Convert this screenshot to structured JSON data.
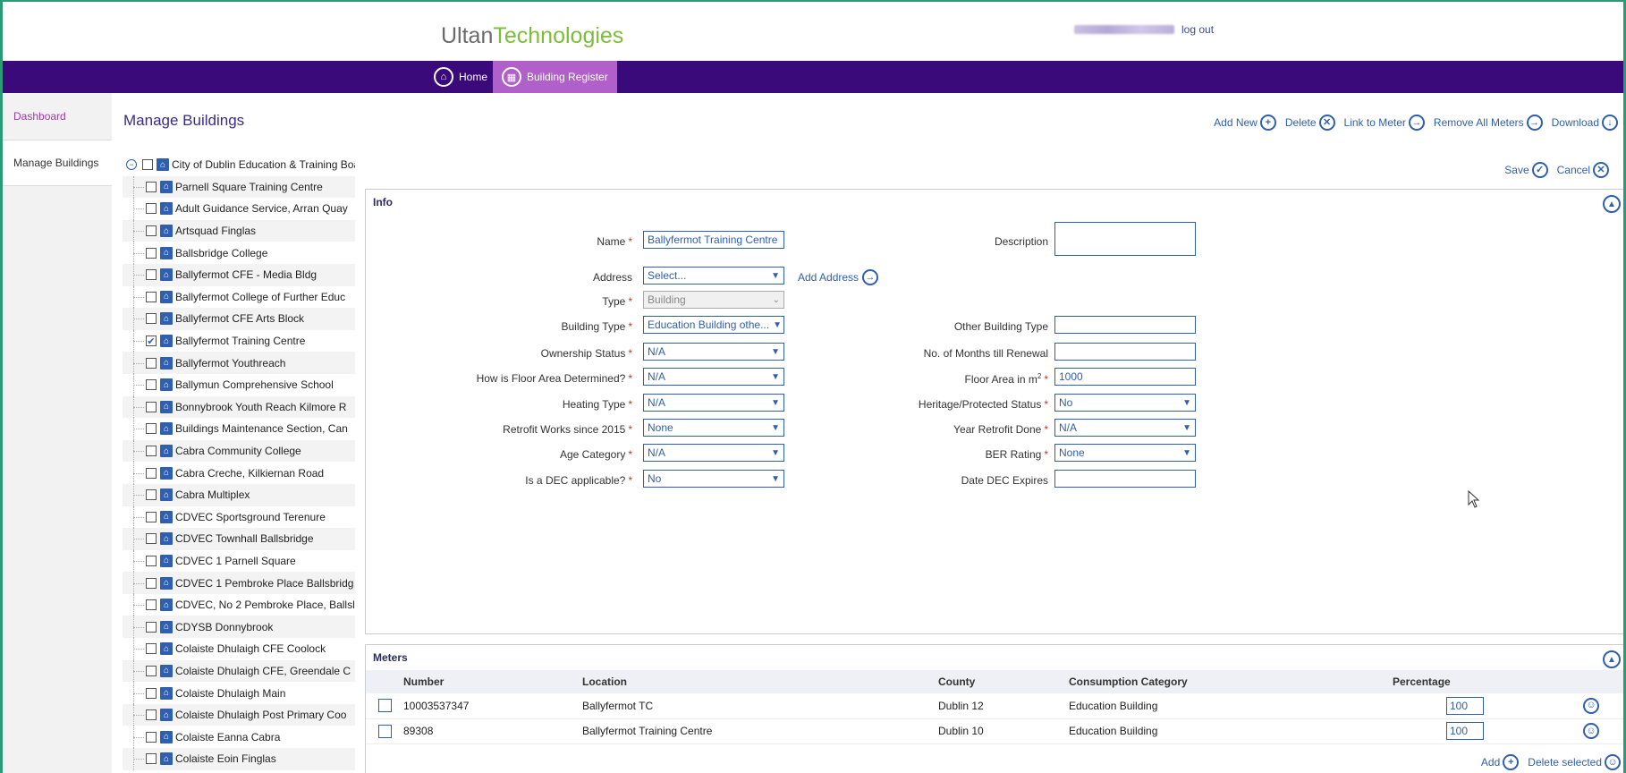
{
  "brand": {
    "part1": "Ultan",
    "part2": "Technologies"
  },
  "user": {
    "logout": "log out"
  },
  "nav": {
    "home": "Home",
    "register": "Building Register"
  },
  "leftnav": {
    "items": [
      "Dashboard",
      "Manage Buildings"
    ]
  },
  "page": {
    "title": "Manage Buildings"
  },
  "actions": {
    "add_new": "Add New",
    "delete": "Delete",
    "link_meter": "Link to Meter",
    "remove_all": "Remove All Meters",
    "download": "Download"
  },
  "form_actions": {
    "save": "Save",
    "cancel": "Cancel"
  },
  "tree": {
    "root": "City of Dublin Education & Training Boa",
    "items": [
      {
        "label": "Parnell Square Training Centre",
        "checked": false
      },
      {
        "label": "Adult Guidance Service, Arran Quay",
        "checked": false
      },
      {
        "label": "Artsquad Finglas",
        "checked": false
      },
      {
        "label": "Ballsbridge College",
        "checked": false
      },
      {
        "label": "Ballyfermot CFE - Media Bldg",
        "checked": false
      },
      {
        "label": "Ballyfermot College of Further Educ",
        "checked": false
      },
      {
        "label": "Ballyfermot CFE Arts Block",
        "checked": false
      },
      {
        "label": "Ballyfermot Training Centre",
        "checked": true
      },
      {
        "label": "Ballyfermot Youthreach",
        "checked": false
      },
      {
        "label": "Ballymun Comprehensive School",
        "checked": false
      },
      {
        "label": "Bonnybrook Youth Reach Kilmore R",
        "checked": false
      },
      {
        "label": "Buildings Maintenance Section, Can",
        "checked": false
      },
      {
        "label": "Cabra Community College",
        "checked": false
      },
      {
        "label": "Cabra Creche, Kilkiernan Road",
        "checked": false
      },
      {
        "label": "Cabra Multiplex",
        "checked": false
      },
      {
        "label": "CDVEC Sportsground Terenure",
        "checked": false
      },
      {
        "label": "CDVEC Townhall Ballsbridge",
        "checked": false
      },
      {
        "label": "CDVEC 1 Parnell Square",
        "checked": false
      },
      {
        "label": "CDVEC 1 Pembroke Place Ballsbridg",
        "checked": false
      },
      {
        "label": "CDVEC, No 2 Pembroke Place, Ballsl",
        "checked": false
      },
      {
        "label": "CDYSB Donnybrook",
        "checked": false
      },
      {
        "label": "Colaiste Dhulaigh CFE Coolock",
        "checked": false
      },
      {
        "label": "Colaiste Dhulaigh CFE, Greendale C",
        "checked": false
      },
      {
        "label": "Colaiste Dhulaigh Main",
        "checked": false
      },
      {
        "label": "Colaiste Dhulaigh Post Primary Coo",
        "checked": false
      },
      {
        "label": "Colaiste Eanna Cabra",
        "checked": false
      },
      {
        "label": "Colaiste Eoin Finglas",
        "checked": false
      }
    ]
  },
  "info": {
    "title": "Info",
    "name_label": "Name",
    "name_value": "Ballyfermot Training Centre",
    "description_label": "Description",
    "address_label": "Address",
    "address_value": "Select...",
    "add_address": "Add Address",
    "type_label": "Type",
    "type_value": "Building",
    "building_type_label": "Building Type",
    "building_type_value": "Education Building othe...",
    "other_building_type_label": "Other Building Type",
    "ownership_label": "Ownership Status",
    "ownership_value": "N/A",
    "months_label": "No. of Months till Renewal",
    "floor_det_label": "How is Floor Area Determined?",
    "floor_det_value": "N/A",
    "floor_area_label": "Floor Area in m",
    "floor_area_sup": "2",
    "floor_area_value": "1000",
    "heating_label": "Heating Type",
    "heating_value": "N/A",
    "heritage_label": "Heritage/Protected Status",
    "heritage_value": "No",
    "retrofit_label": "Retrofit Works since 2015",
    "retrofit_value": "None",
    "year_retrofit_label": "Year Retrofit Done",
    "year_retrofit_value": "N/A",
    "age_label": "Age Category",
    "age_value": "N/A",
    "ber_label": "BER Rating",
    "ber_value": "None",
    "dec_label": "Is a DEC applicable?",
    "dec_value": "No",
    "dec_expires_label": "Date DEC Expires"
  },
  "meters": {
    "title": "Meters",
    "columns": [
      "Number",
      "Location",
      "County",
      "Consumption Category",
      "Percentage"
    ],
    "rows": [
      {
        "number": "10003537347",
        "location": "Ballyfermot TC",
        "county": "Dublin 12",
        "category": "Education Building",
        "percentage": "100"
      },
      {
        "number": "89308",
        "location": "Ballyfermot Training Centre",
        "county": "Dublin 10",
        "category": "Education Building",
        "percentage": "100"
      }
    ],
    "add": "Add",
    "delete_selected": "Delete selected"
  }
}
